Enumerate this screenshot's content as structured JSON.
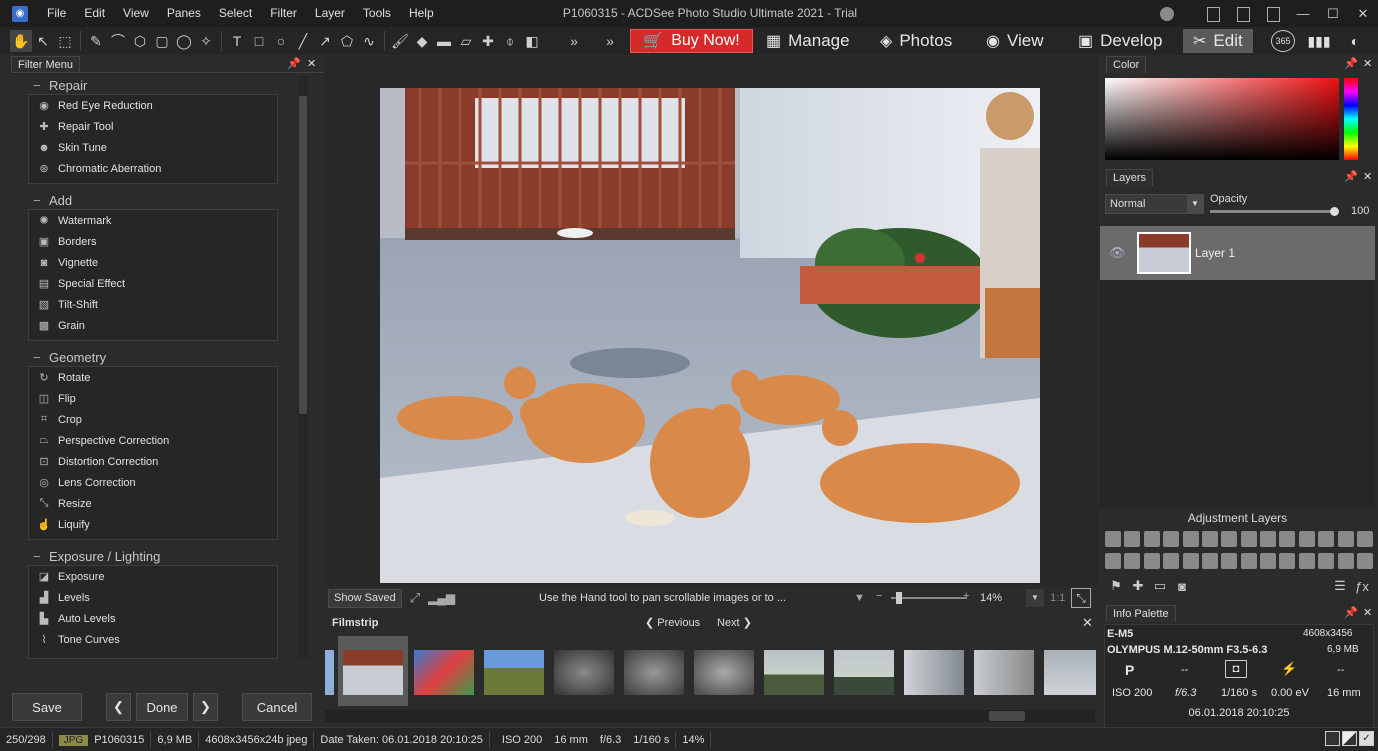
{
  "menu": [
    "File",
    "Edit",
    "View",
    "Panes",
    "Select",
    "Filter",
    "Layer",
    "Tools",
    "Help"
  ],
  "window_title": "P1060315 - ACDSee Photo Studio Ultimate 2021 - Trial",
  "toolbar": {
    "buy_now": "Buy Now!",
    "modes": {
      "manage": "Manage",
      "photos": "Photos",
      "view": "View",
      "develop": "Develop",
      "edit": "Edit"
    },
    "badge_365": "365"
  },
  "filter_menu": {
    "tab": "Filter Menu",
    "groups": [
      {
        "title": "Repair",
        "items": [
          "Red Eye Reduction",
          "Repair Tool",
          "Skin Tune",
          "Chromatic Aberration"
        ]
      },
      {
        "title": "Add",
        "items": [
          "Watermark",
          "Borders",
          "Vignette",
          "Special Effect",
          "Tilt-Shift",
          "Grain"
        ]
      },
      {
        "title": "Geometry",
        "items": [
          "Rotate",
          "Flip",
          "Crop",
          "Perspective Correction",
          "Distortion Correction",
          "Lens Correction",
          "Resize",
          "Liquify"
        ]
      },
      {
        "title": "Exposure / Lighting",
        "items": [
          "Exposure",
          "Levels",
          "Auto Levels",
          "Tone Curves"
        ]
      }
    ],
    "save": "Save",
    "done": "Done",
    "cancel": "Cancel"
  },
  "viewer": {
    "show_saved": "Show Saved",
    "hint": "Use the Hand tool to pan scrollable images or to ...",
    "zoom": "14%",
    "ratio": "1:1"
  },
  "filmstrip": {
    "tab": "Filmstrip",
    "previous": "Previous",
    "next": "Next"
  },
  "color_panel": {
    "tab": "Color"
  },
  "layers_panel": {
    "tab": "Layers",
    "blend_mode": "Normal",
    "opacity_label": "Opacity",
    "opacity_value": "100",
    "opacity_level": 1.0,
    "layer_name": "Layer 1"
  },
  "adjustment_layers": {
    "title": "Adjustment Layers"
  },
  "info_palette": {
    "tab": "Info Palette",
    "camera": "E-M5",
    "dimensions": "4608x3456",
    "lens": "OLYMPUS M.12-50mm F3.5-6.3",
    "size": "6,9 MB",
    "mode": "P",
    "dash1": "--",
    "dash2": "--",
    "dash3": "--",
    "iso": "ISO 200",
    "fstop": "f/6.3",
    "shutter": "1/160 s",
    "ev": "0.00 eV",
    "focal": "16 mm",
    "datetime": "06.01.2018 20:10:25"
  },
  "statusbar": {
    "count": "250/298",
    "format": "JPG",
    "filename": "P1060315",
    "filesize": "6,9 MB",
    "dims": "4608x3456x24b jpeg",
    "date_taken": "Date Taken: 06.01.2018 20:10:25",
    "iso": "ISO 200",
    "focal": "16 mm",
    "fstop": "f/6.3",
    "shutter": "1/160 s",
    "zoom": "14%"
  },
  "colors": {
    "buy_now": "#d42a2a",
    "edit_active": "#5a5a5a",
    "layer_selected": "#6b6b6b"
  }
}
